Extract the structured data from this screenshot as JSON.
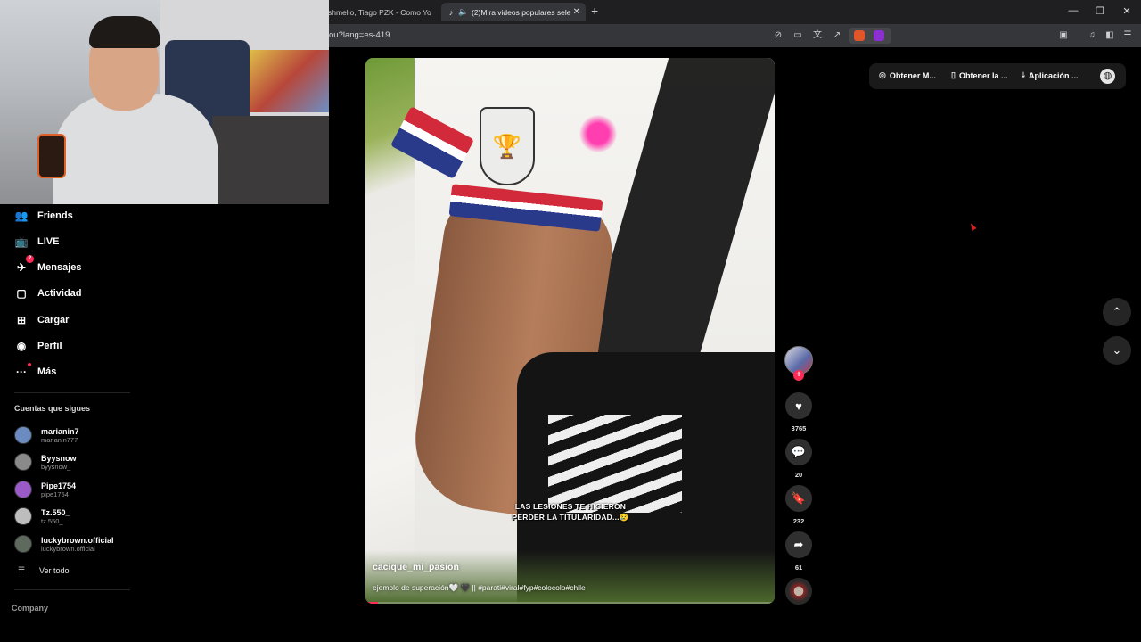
{
  "browser": {
    "tabs": [
      {
        "label": "shmello, Tiago PZK - Como Yo :("
      },
      {
        "label": "(2)Mira videos populares sele",
        "icon": "tiktok-icon"
      }
    ],
    "url": "ou?lang=es-419"
  },
  "sidebar": {
    "nav": [
      {
        "label": "Friends",
        "icon": "friends-icon"
      },
      {
        "label": "LIVE",
        "icon": "live-icon"
      },
      {
        "label": "Mensajes",
        "icon": "messages-icon",
        "badge": "2"
      },
      {
        "label": "Actividad",
        "icon": "activity-icon"
      },
      {
        "label": "Cargar",
        "icon": "upload-icon"
      },
      {
        "label": "Perfil",
        "icon": "profile-icon"
      },
      {
        "label": "Más",
        "icon": "more-icon"
      }
    ],
    "following_title": "Cuentas que sigues",
    "accounts": [
      {
        "name": "marianin7",
        "handle": "marianin777",
        "color": "#6a8cc0"
      },
      {
        "name": "Byysnow",
        "handle": "byysnow_",
        "color": "#8a8a8a"
      },
      {
        "name": "Pipe1754",
        "handle": "pipe1754",
        "color": "#9a5ac8"
      },
      {
        "name": "Tz.550_",
        "handle": "tz.550_",
        "color": "#bdbdbd"
      },
      {
        "name": "luckybrown.official",
        "handle": "luckybrown.official",
        "color": "#5f6a5f"
      }
    ],
    "see_all": "Ver todo",
    "company": "Company"
  },
  "video": {
    "overlay_text": "LAS LESIONES TE HICIERON PERDER LA TITULARIDAD...😢",
    "author": "cacique_mi_pasion",
    "description": "ejemplo de superación🤍 🖤 || #parati#viral#fyp#colocolo#chile",
    "progress": 0.03
  },
  "actions": {
    "likes": "3765",
    "comments": "20",
    "saves": "232",
    "shares": "61"
  },
  "topbar": {
    "get_coins": "Obtener M...",
    "get_app": "Obtener la ...",
    "desktop_app": "Aplicación ..."
  },
  "colors": {
    "accent": "#fe2c55",
    "background": "#000000"
  }
}
